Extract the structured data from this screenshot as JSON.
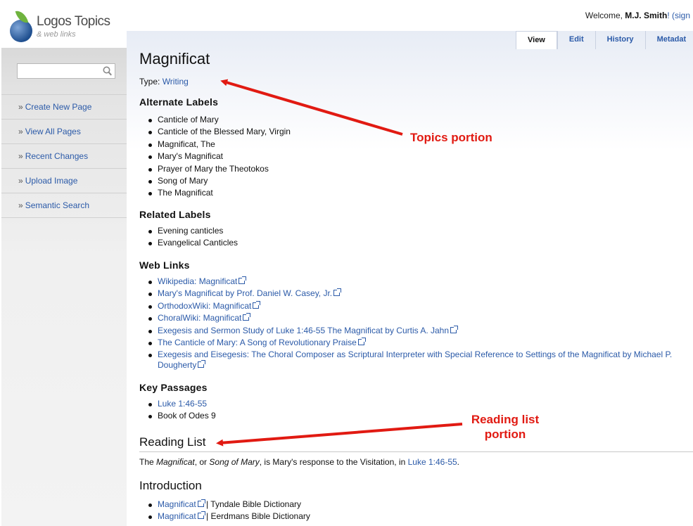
{
  "brand": {
    "title": "Logos Topics",
    "subtitle": "& web links"
  },
  "welcome": {
    "prefix": "Welcome, ",
    "user": "M.J. Smith",
    "suffix": "! (sign"
  },
  "search": {
    "placeholder": ""
  },
  "nav": [
    {
      "label": "Create New Page"
    },
    {
      "label": "View All Pages"
    },
    {
      "label": "Recent Changes"
    },
    {
      "label": "Upload Image"
    },
    {
      "label": "Semantic Search"
    }
  ],
  "nav_prefix": "»",
  "tabs": [
    {
      "label": "View"
    },
    {
      "label": "Edit"
    },
    {
      "label": "History"
    },
    {
      "label": "Metadat"
    }
  ],
  "page": {
    "title": "Magnificat",
    "type_label": "Type: ",
    "type_value": "Writing",
    "alternate_heading": "Alternate Labels",
    "alternate": [
      "Canticle of Mary",
      "Canticle of the Blessed Mary, Virgin",
      "Magnificat, The",
      "Mary's Magnificat",
      "Prayer of Mary the Theotokos",
      "Song of Mary",
      "The Magnificat"
    ],
    "related_heading": "Related Labels",
    "related": [
      "Evening canticles",
      "Evangelical Canticles"
    ],
    "weblinks_heading": "Web Links",
    "weblinks": [
      "Wikipedia: Magnificat",
      "Mary's Magnificat by Prof. Daniel W. Casey, Jr.",
      "OrthodoxWiki: Magnificat",
      "ChoralWiki: Magnificat",
      "Exegesis and Sermon Study of Luke 1:46-55 The Magnificat by Curtis A. Jahn",
      "The Canticle of Mary: A Song of Revolutionary Praise",
      "Exegesis and Eisegesis: The Choral Composer as Scriptural Interpreter with Special Reference to Settings of the Magnificat by Michael P. Dougherty"
    ],
    "passages_heading": "Key Passages",
    "passage_link": "Luke 1:46-55",
    "passage_text": "Book of Odes 9",
    "reading_heading": "Reading List",
    "reading_para": {
      "p1": "The ",
      "i1": "Magnificat",
      "p2": ", or ",
      "i2": "Song of Mary",
      "p3": ", is Mary's response to the Visitation, in ",
      "link": "Luke 1:46-55",
      "p4": "."
    },
    "intro_heading": "Introduction",
    "intro": [
      {
        "link": "Magnificat",
        "source": " | Tyndale Bible Dictionary"
      },
      {
        "link": "Magnificat",
        "source": " | Eerdmans Bible Dictionary"
      }
    ]
  },
  "annotations": {
    "topics": "Topics portion",
    "reading_line1": "Reading list",
    "reading_line2": "portion"
  },
  "colors": {
    "link": "#2b5aa8",
    "annotation": "#e11a12"
  }
}
